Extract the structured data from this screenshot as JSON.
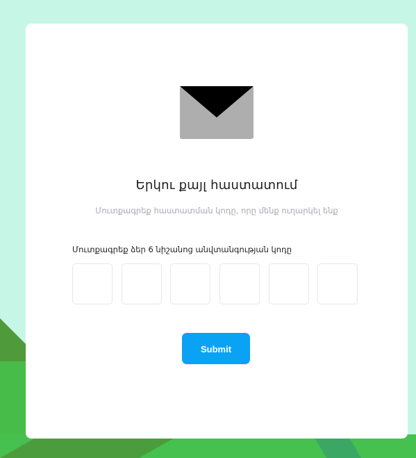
{
  "verification": {
    "title": "Երկու քայլ հաստատում",
    "subtitle": "Մուտքագրեք հաստատման կոդը, որը մենք ուղարկել ենք",
    "code_label": "Մուտքագրեք ձեր 6 նիշանոց անվտանգության կոդը",
    "code_digits": [
      "",
      "",
      "",
      "",
      "",
      ""
    ],
    "submit_label": "Submit"
  },
  "icons": {
    "envelope": "envelope-icon"
  },
  "colors": {
    "page_background": "#c6f7e6",
    "card_background": "#ffffff",
    "accent": "#0aa2f2",
    "envelope_body": "#aeaeae",
    "envelope_flap": "#000000",
    "decor_green_dark": "#4a9a3d",
    "decor_green": "#47bc48"
  }
}
